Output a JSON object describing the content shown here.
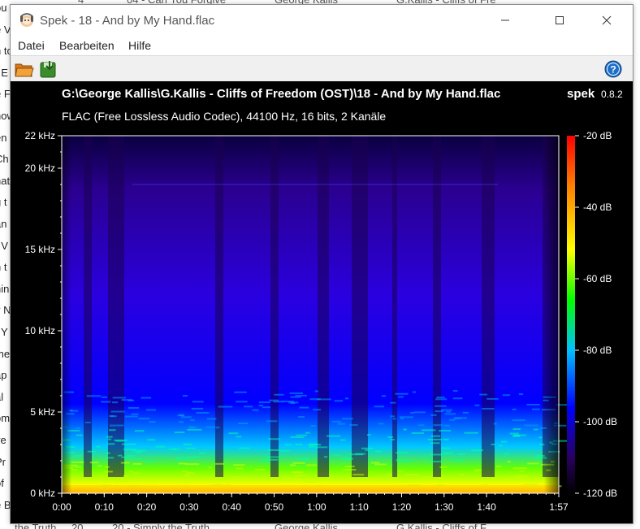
{
  "background_app": {
    "left_fragments": [
      "ou Forgive",
      "e V",
      "n to",
      "t E",
      "e F",
      "now",
      "en",
      "Ch",
      "nat",
      "g t",
      "an",
      "f V",
      "n t",
      "hin",
      "y N",
      "t Y",
      "me",
      "ap",
      "al",
      "om",
      "ve",
      "Pr",
      "of",
      "e B"
    ],
    "top_fragments": [
      "4",
      "04 - Can You Forgive",
      "George Kallis",
      "G.Kallis - Cliffs of Fre"
    ],
    "bottom_fragments": [
      "the Truth",
      "20",
      "20 - Simply the Truth",
      "George Kallis",
      "G.Kallis - Cliffs of F"
    ]
  },
  "window": {
    "title": "Spek - 18 - And by My Hand.flac"
  },
  "menu": {
    "items": [
      "Datei",
      "Bearbeiten",
      "Hilfe"
    ]
  },
  "toolbar": {
    "open_icon": "folder-open-icon",
    "save_icon": "save-icon",
    "help_icon": "help-icon"
  },
  "spek": {
    "file_path": "G:\\George Kallis\\G.Kallis - Cliffs of Freedom (OST)\\18 - And by My Hand.flac",
    "app_name": "spek",
    "version": "0.8.2",
    "file_info": "FLAC (Free Lossless Audio Codec), 44100 Hz, 16 bits, 2 Kanäle",
    "freq_labels": [
      "22 kHz",
      "20 kHz",
      "15 kHz",
      "10 kHz",
      "5 kHz",
      "0 kHz"
    ],
    "time_labels": [
      "0:00",
      "0:10",
      "0:20",
      "0:30",
      "0:40",
      "0:50",
      "1:00",
      "1:10",
      "1:20",
      "1:30",
      "1:40",
      "1:57"
    ],
    "db_labels": [
      "-20 dB",
      "-40 dB",
      "-60 dB",
      "-80 dB",
      "-100 dB",
      "-120 dB"
    ],
    "colors": {
      "background": "#000000",
      "db_scale": [
        "#ff0000",
        "#ff8000",
        "#ffff00",
        "#00ff00",
        "#00c0ff",
        "#0000ff",
        "#2a0060",
        "#000000"
      ]
    }
  },
  "chart_data": {
    "type": "heatmap",
    "x_label_unit": "time (m:ss)",
    "xlim": [
      "0:00",
      "1:57"
    ],
    "ylim_khz": [
      0,
      22
    ],
    "y_ticks_khz": [
      22,
      20,
      15,
      10,
      5,
      0
    ],
    "x_ticks": [
      "0:00",
      "0:10",
      "0:20",
      "0:30",
      "0:40",
      "0:50",
      "1:00",
      "1:10",
      "1:20",
      "1:30",
      "1:40",
      "1:57"
    ],
    "colorbar_db": [
      -20,
      -40,
      -60,
      -80,
      -100,
      -120
    ],
    "colorbar_range_db": [
      -120,
      -20
    ]
  }
}
